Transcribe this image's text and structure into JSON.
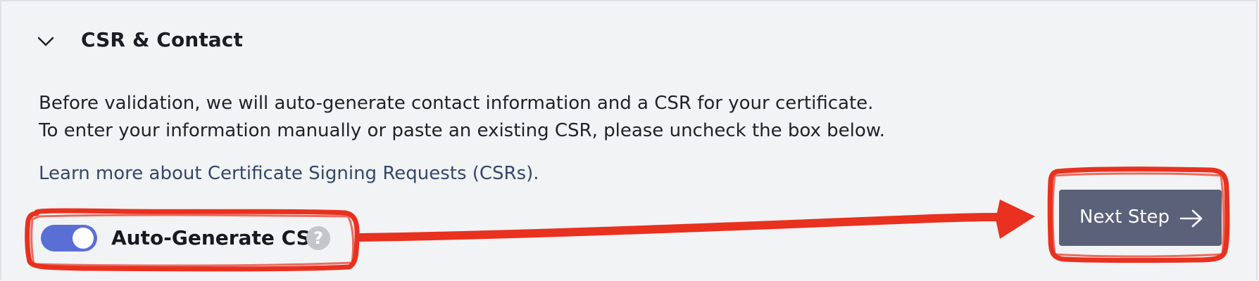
{
  "section": {
    "title": "CSR & Contact",
    "expanded": true,
    "chevron_icon": "chevron-down-icon"
  },
  "description": {
    "line1": "Before validation, we will auto-generate contact information and a CSR for your certificate.",
    "line2": "To enter your information manually or paste an existing CSR, please uncheck the box below."
  },
  "learn_more": {
    "text": "Learn more about Certificate Signing Requests (CSRs)."
  },
  "auto_generate": {
    "label": "Auto-Generate CSR",
    "enabled": true,
    "help_glyph": "?",
    "help_icon": "question-circle-icon"
  },
  "next_button": {
    "label": "Next Step",
    "icon": "arrow-right-icon"
  },
  "colors": {
    "background": "#f2f3f4",
    "toggle_on": "#5a6fd6",
    "button": "#5b6179",
    "link": "#34476a",
    "annotation": "#e8311f"
  }
}
